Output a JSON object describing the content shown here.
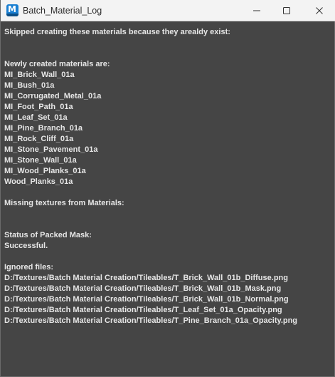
{
  "window": {
    "title": "Batch_Material_Log"
  },
  "log": {
    "lines": [
      "Skipped creating these materials because they arealdy exist:",
      "",
      "",
      "Newly created materials are:",
      "MI_Brick_Wall_01a",
      "MI_Bush_01a",
      "MI_Corrugated_Metal_01a",
      "MI_Foot_Path_01a",
      "MI_Leaf_Set_01a",
      "MI_Pine_Branch_01a",
      "MI_Rock_Cliff_01a",
      "MI_Stone_Pavement_01a",
      "MI_Stone_Wall_01a",
      "MI_Wood_Planks_01a",
      "Wood_Planks_01a",
      "",
      "Missing textures from Materials:",
      "",
      "",
      "Status of Packed Mask:",
      "Successful.",
      "",
      "Ignored files:",
      "D:/Textures/Batch Material Creation/Tileables/T_Brick_Wall_01b_Diffuse.png",
      "D:/Textures/Batch Material Creation/Tileables/T_Brick_Wall_01b_Mask.png",
      "D:/Textures/Batch Material Creation/Tileables/T_Brick_Wall_01b_Normal.png",
      "D:/Textures/Batch Material Creation/Tileables/T_Leaf_Set_01a_Opacity.png",
      "D:/Textures/Batch Material Creation/Tileables/T_Pine_Branch_01a_Opacity.png"
    ]
  },
  "colors": {
    "background": "#454545",
    "text": "#e6e6e6",
    "titlebar": "#f3f3f3",
    "app_icon": "#1a7fd1"
  },
  "icons": {
    "app": "app-logo-icon",
    "minimize": "minimize-icon",
    "maximize": "maximize-icon",
    "close": "close-icon"
  }
}
